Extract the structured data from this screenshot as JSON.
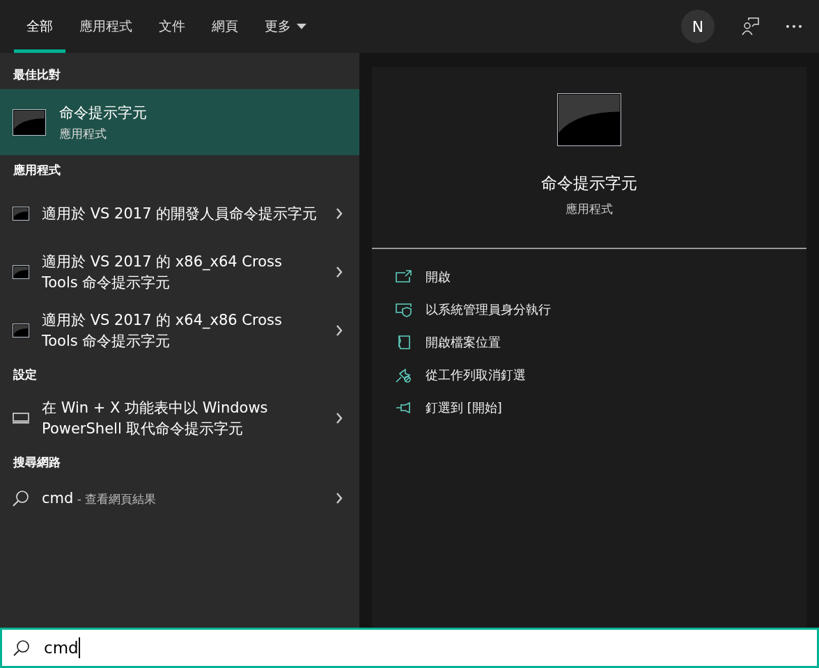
{
  "tabs": [
    {
      "label": "全部",
      "selected": true,
      "kind": "plain"
    },
    {
      "label": "應用程式",
      "selected": false,
      "kind": "plain"
    },
    {
      "label": "文件",
      "selected": false,
      "kind": "plain"
    },
    {
      "label": "網頁",
      "selected": false,
      "kind": "plain"
    },
    {
      "label": "更多",
      "selected": false,
      "kind": "dropdown"
    }
  ],
  "account": {
    "initial": "N"
  },
  "results": [
    {
      "heading": "最佳比對",
      "items": [
        {
          "kind": "best_match",
          "title": "命令提示字元",
          "subtitle": "應用程式",
          "selected": true
        }
      ]
    },
    {
      "heading": "應用程式",
      "items": [
        {
          "kind": "app",
          "title": "適用於 VS 2017 的開發人員命令提示字元",
          "selected": false
        },
        {
          "kind": "app",
          "title": "適用於 VS 2017 的 x86_x64 Cross Tools 命令提示字元",
          "selected": false
        },
        {
          "kind": "app",
          "title": "適用於 VS 2017 的 x64_x86 Cross Tools 命令提示字元",
          "selected": false
        }
      ]
    },
    {
      "heading": "設定",
      "items": [
        {
          "kind": "setting",
          "title": "在 Win + X 功能表中以 Windows PowerShell 取代命令提示字元",
          "selected": false
        }
      ]
    },
    {
      "heading": "搜尋網路",
      "items": [
        {
          "kind": "web",
          "title": "cmd",
          "hint": "- 查看網頁結果",
          "selected": false
        }
      ]
    }
  ],
  "preview": {
    "title": "命令提示字元",
    "subtitle": "應用程式",
    "actions": [
      {
        "kind": "open",
        "label": "開啟"
      },
      {
        "kind": "run_as_admin",
        "label": "以系統管理員身分執行"
      },
      {
        "kind": "open_location",
        "label": "開啟檔案位置"
      },
      {
        "kind": "unpin_taskbar",
        "label": "從工作列取消釘選"
      },
      {
        "kind": "pin_start",
        "label": "釘選到 [開始]"
      }
    ]
  },
  "search": {
    "value": "cmd"
  }
}
